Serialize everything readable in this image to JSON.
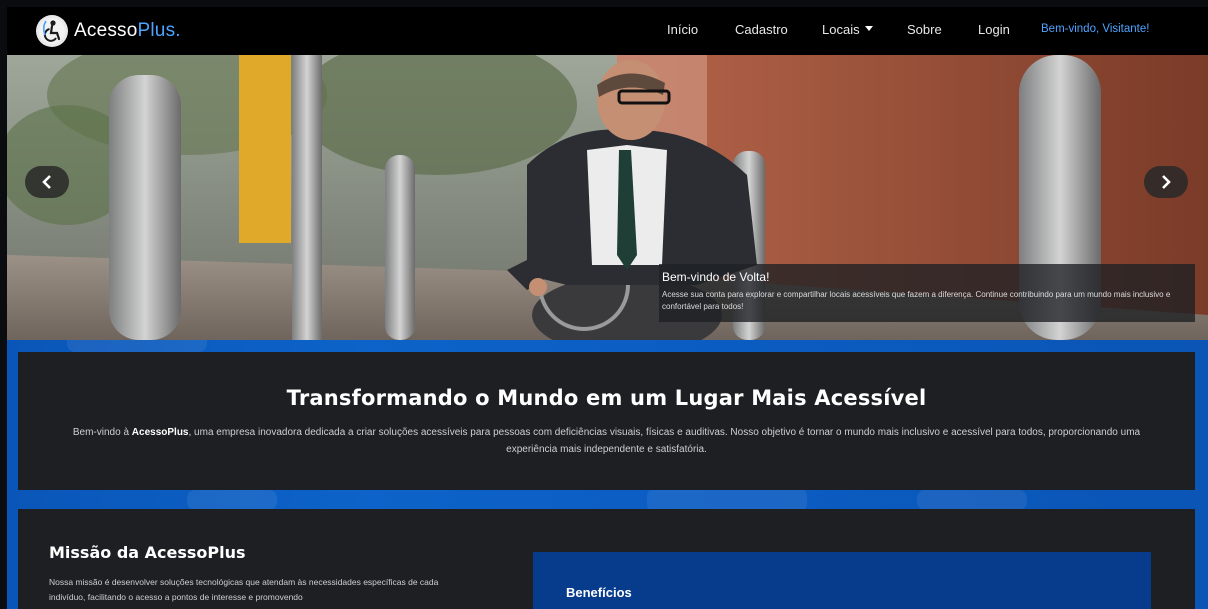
{
  "brand": {
    "name": "Acesso",
    "name_accent": "Plus."
  },
  "nav": {
    "items": [
      {
        "label": "Início"
      },
      {
        "label": "Cadastro"
      },
      {
        "label": "Locais"
      },
      {
        "label": "Sobre"
      },
      {
        "label": "Login"
      }
    ],
    "welcome": "Bem-vindo, Visitante!"
  },
  "hero": {
    "caption_title": "Bem-vindo de Volta!",
    "caption_text": "Acesse sua conta para explorar e compartilhar locais acessíveis que fazem a diferença. Continue contribuindo para um mundo mais inclusivo e confortável para todos!",
    "prev_icon": "chevron-left-icon",
    "next_icon": "chevron-right-icon"
  },
  "intro": {
    "title": "Transformando o Mundo em um Lugar Mais Acessível",
    "text_before": "Bem-vindo à ",
    "text_bold": "AcessoPlus",
    "text_after": ", uma empresa inovadora dedicada a criar soluções acessíveis para pessoas com deficiências visuais, físicas e auditivas. Nosso objetivo é tornar o mundo mais inclusivo e acessível para todos, proporcionando uma experiência mais independente e satisfatória."
  },
  "mission": {
    "title": "Missão da AcessoPlus",
    "text": "Nossa missão é desenvolver soluções tecnológicas que atendam às necessidades específicas de cada indivíduo, facilitando o acesso a pontos de interesse e promovendo",
    "benefits_title": "Benefícios"
  },
  "colors": {
    "accent": "#4da3ff",
    "band": "#0b5cc2",
    "panel": "#1d1f23",
    "benefits": "#073c8c"
  }
}
